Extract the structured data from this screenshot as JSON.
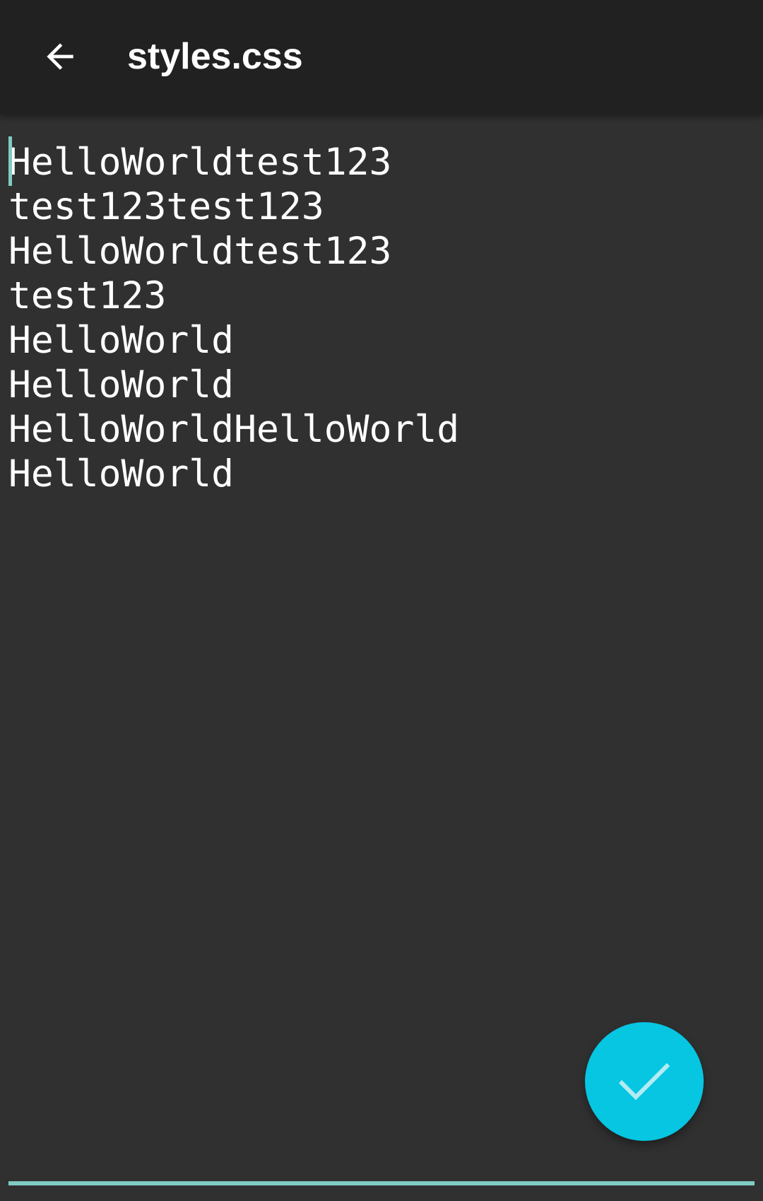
{
  "toolbar": {
    "title": "styles.css",
    "back_icon": "arrow-back-icon"
  },
  "editor": {
    "lines": [
      "HelloWorldtest123",
      "test123test123",
      "HelloWorldtest123",
      "test123",
      "HelloWorld",
      "HelloWorld",
      "HelloWorldHelloWorld",
      "HelloWorld"
    ]
  },
  "fab": {
    "icon": "check-icon"
  },
  "colors": {
    "toolbar_bg": "#212121",
    "editor_bg": "#303030",
    "accent": "#80cbc4",
    "fab": "#06c6e2",
    "check": "#b2ebf2"
  }
}
